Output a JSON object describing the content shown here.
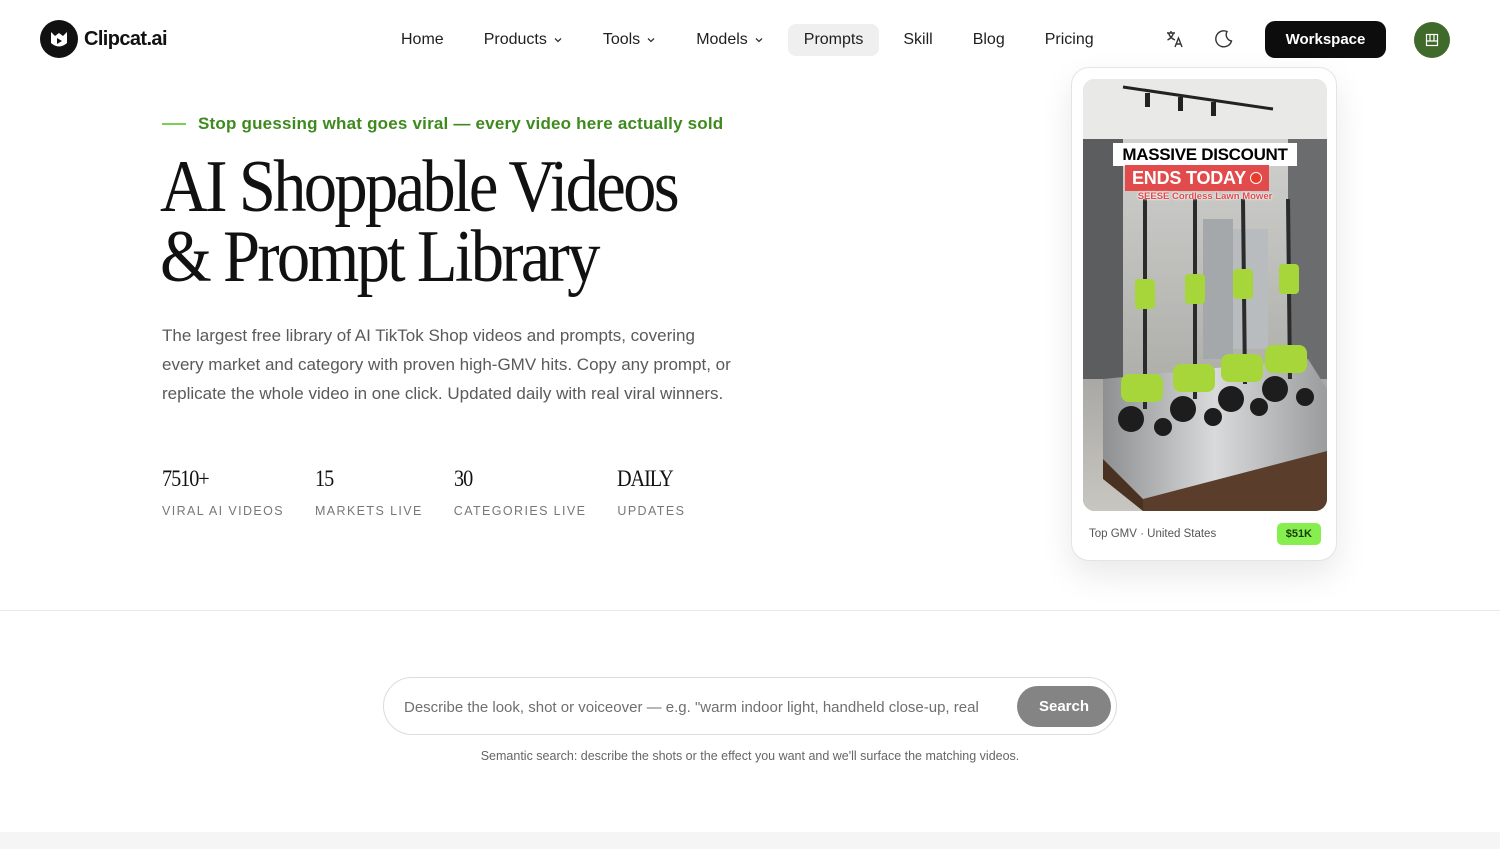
{
  "brand": {
    "name": "Clipcat.ai"
  },
  "nav": {
    "items": [
      {
        "label": "Home",
        "dropdown": false,
        "active": false
      },
      {
        "label": "Products",
        "dropdown": true,
        "active": false
      },
      {
        "label": "Tools",
        "dropdown": true,
        "active": false
      },
      {
        "label": "Models",
        "dropdown": true,
        "active": false
      },
      {
        "label": "Prompts",
        "dropdown": false,
        "active": true
      },
      {
        "label": "Skill",
        "dropdown": false,
        "active": false
      },
      {
        "label": "Blog",
        "dropdown": false,
        "active": false
      },
      {
        "label": "Pricing",
        "dropdown": false,
        "active": false
      }
    ],
    "icons": [
      "translate-icon",
      "moon-icon"
    ],
    "workspace_label": "Workspace",
    "avatar_color": "#3f6a2b"
  },
  "hero": {
    "eyebrow": "Stop guessing what goes viral — every video here actually sold",
    "title_line1": "AI Shoppable Videos",
    "title_line2": "& Prompt Library",
    "description": "The largest free library of AI TikTok Shop videos and prompts, covering every market and category with proven high-GMV hits. Copy any prompt, or replicate the whole video in one click. Updated daily with real viral winners.",
    "stats": [
      {
        "value": "7510+",
        "label": "VIRAL AI VIDEOS"
      },
      {
        "value": "15",
        "label": "MARKETS LIVE"
      },
      {
        "value": "30",
        "label": "CATEGORIES LIVE"
      },
      {
        "value": "DAILY",
        "label": "UPDATES"
      }
    ]
  },
  "video_card": {
    "overlay_line1": "MASSIVE DISCOUNT",
    "overlay_line2": "ENDS TODAY",
    "overlay_line3": "SEESE Cordless Lawn Mower",
    "caption": "Top GMV · United States",
    "gmv": "$51K"
  },
  "search": {
    "placeholder": "Describe the look, shot or voiceover — e.g. \"warm indoor light, handheld close-up, real",
    "button_label": "Search",
    "hint": "Semantic search: describe the shots or the effect you want and we'll surface the matching videos."
  },
  "colors": {
    "accent_green": "#3f8a1f",
    "badge_green": "#86ee4e",
    "primary_dark": "#0d0d0d"
  }
}
